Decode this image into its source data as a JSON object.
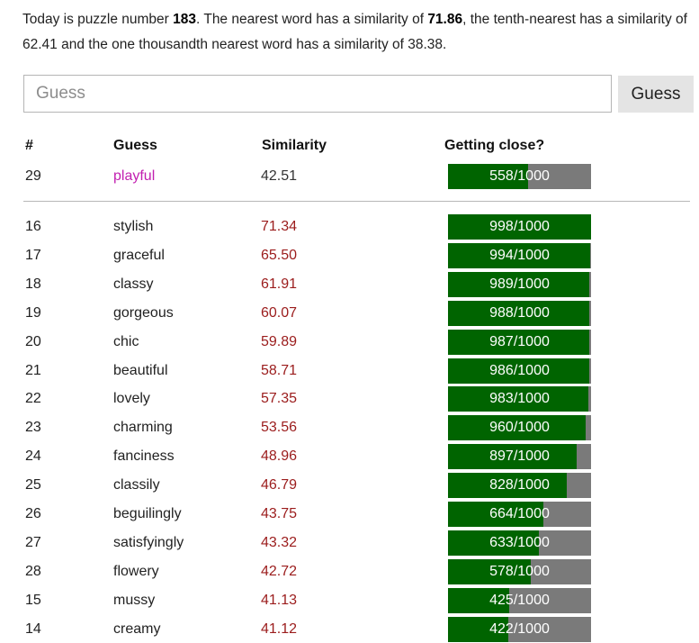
{
  "intro": {
    "t1": "Today is puzzle number ",
    "puzzle_number": "183",
    "t2": ". The nearest word has a similarity of ",
    "nearest": "71.86",
    "t3": ", the tenth-nearest has a similarity of 62.41 and the one thousandth nearest word has a similarity of 38.38."
  },
  "input": {
    "placeholder": "Guess",
    "value": ""
  },
  "guess_button_label": "Guess",
  "table": {
    "headers": {
      "num": "#",
      "guess": "Guess",
      "similarity": "Similarity",
      "close": "Getting close?"
    },
    "latest": {
      "num": "29",
      "word": "playful",
      "similarity": "42.51",
      "rank": 558,
      "rank_label": "558/1000"
    },
    "rows": [
      {
        "num": "16",
        "word": "stylish",
        "similarity": "71.34",
        "rank": 998,
        "rank_label": "998/1000"
      },
      {
        "num": "17",
        "word": "graceful",
        "similarity": "65.50",
        "rank": 994,
        "rank_label": "994/1000"
      },
      {
        "num": "18",
        "word": "classy",
        "similarity": "61.91",
        "rank": 989,
        "rank_label": "989/1000"
      },
      {
        "num": "19",
        "word": "gorgeous",
        "similarity": "60.07",
        "rank": 988,
        "rank_label": "988/1000"
      },
      {
        "num": "20",
        "word": "chic",
        "similarity": "59.89",
        "rank": 987,
        "rank_label": "987/1000"
      },
      {
        "num": "21",
        "word": "beautiful",
        "similarity": "58.71",
        "rank": 986,
        "rank_label": "986/1000"
      },
      {
        "num": "22",
        "word": "lovely",
        "similarity": "57.35",
        "rank": 983,
        "rank_label": "983/1000"
      },
      {
        "num": "23",
        "word": "charming",
        "similarity": "53.56",
        "rank": 960,
        "rank_label": "960/1000"
      },
      {
        "num": "24",
        "word": "fanciness",
        "similarity": "48.96",
        "rank": 897,
        "rank_label": "897/1000"
      },
      {
        "num": "25",
        "word": "classily",
        "similarity": "46.79",
        "rank": 828,
        "rank_label": "828/1000"
      },
      {
        "num": "26",
        "word": "beguilingly",
        "similarity": "43.75",
        "rank": 664,
        "rank_label": "664/1000"
      },
      {
        "num": "27",
        "word": "satisfyingly",
        "similarity": "43.32",
        "rank": 633,
        "rank_label": "633/1000"
      },
      {
        "num": "28",
        "word": "flowery",
        "similarity": "42.72",
        "rank": 578,
        "rank_label": "578/1000"
      },
      {
        "num": "15",
        "word": "mussy",
        "similarity": "41.13",
        "rank": 425,
        "rank_label": "425/1000"
      },
      {
        "num": "14",
        "word": "creamy",
        "similarity": "41.12",
        "rank": 422,
        "rank_label": "422/1000"
      }
    ]
  },
  "colors": {
    "bar_fill": "#006400",
    "bar_track": "#7a7a7a",
    "latest_word": "#c21fb0",
    "similarity_text": "#9b1c1c"
  }
}
